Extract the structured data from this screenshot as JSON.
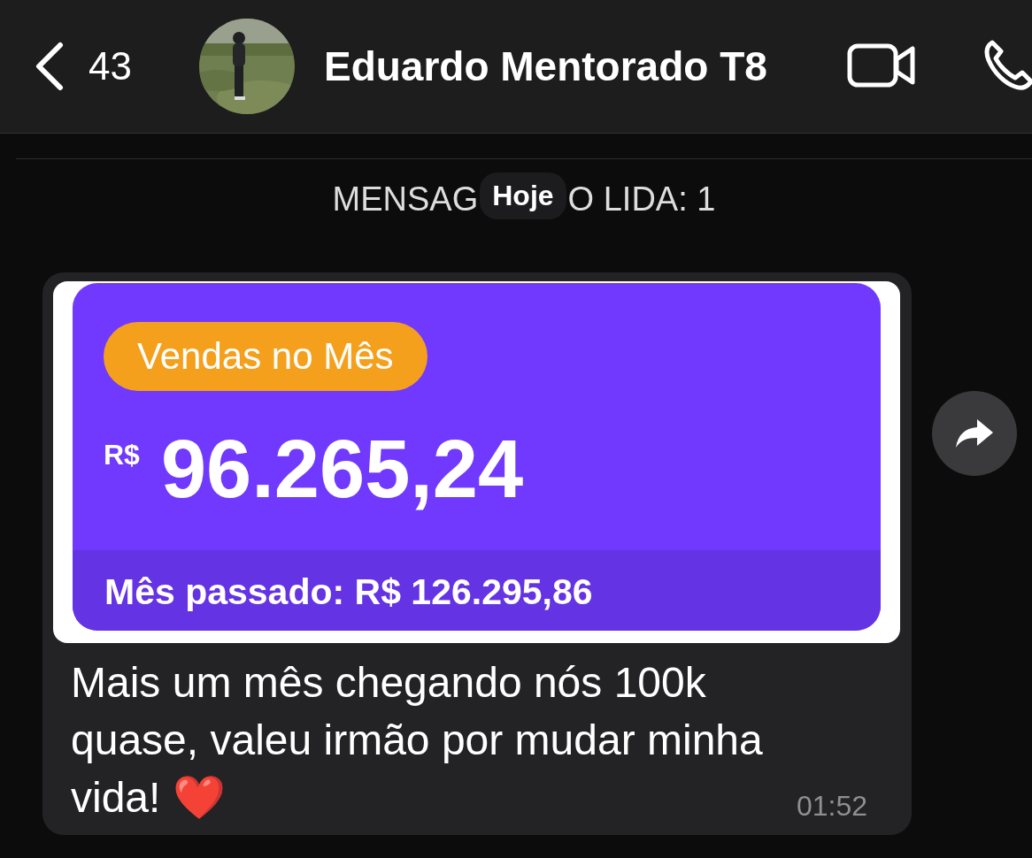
{
  "header": {
    "back_count": "43",
    "contact_name": "Eduardo Mentorado T8"
  },
  "unread_banner": {
    "text_before": "MENSAG",
    "text_after": "O LIDA: 1"
  },
  "date_chip": "Hoje",
  "messages": [
    {
      "kind": "image_text",
      "incoming": true,
      "card": {
        "badge": "Vendas no Mês",
        "currency": "R$",
        "amount": "96.265,24",
        "footer": "Mês passado: R$ 126.295,86"
      },
      "text": "Mais um mês chegando nós 100k quase, valeu irmão por mudar minha vida! ❤️",
      "time": "01:52"
    }
  ]
}
